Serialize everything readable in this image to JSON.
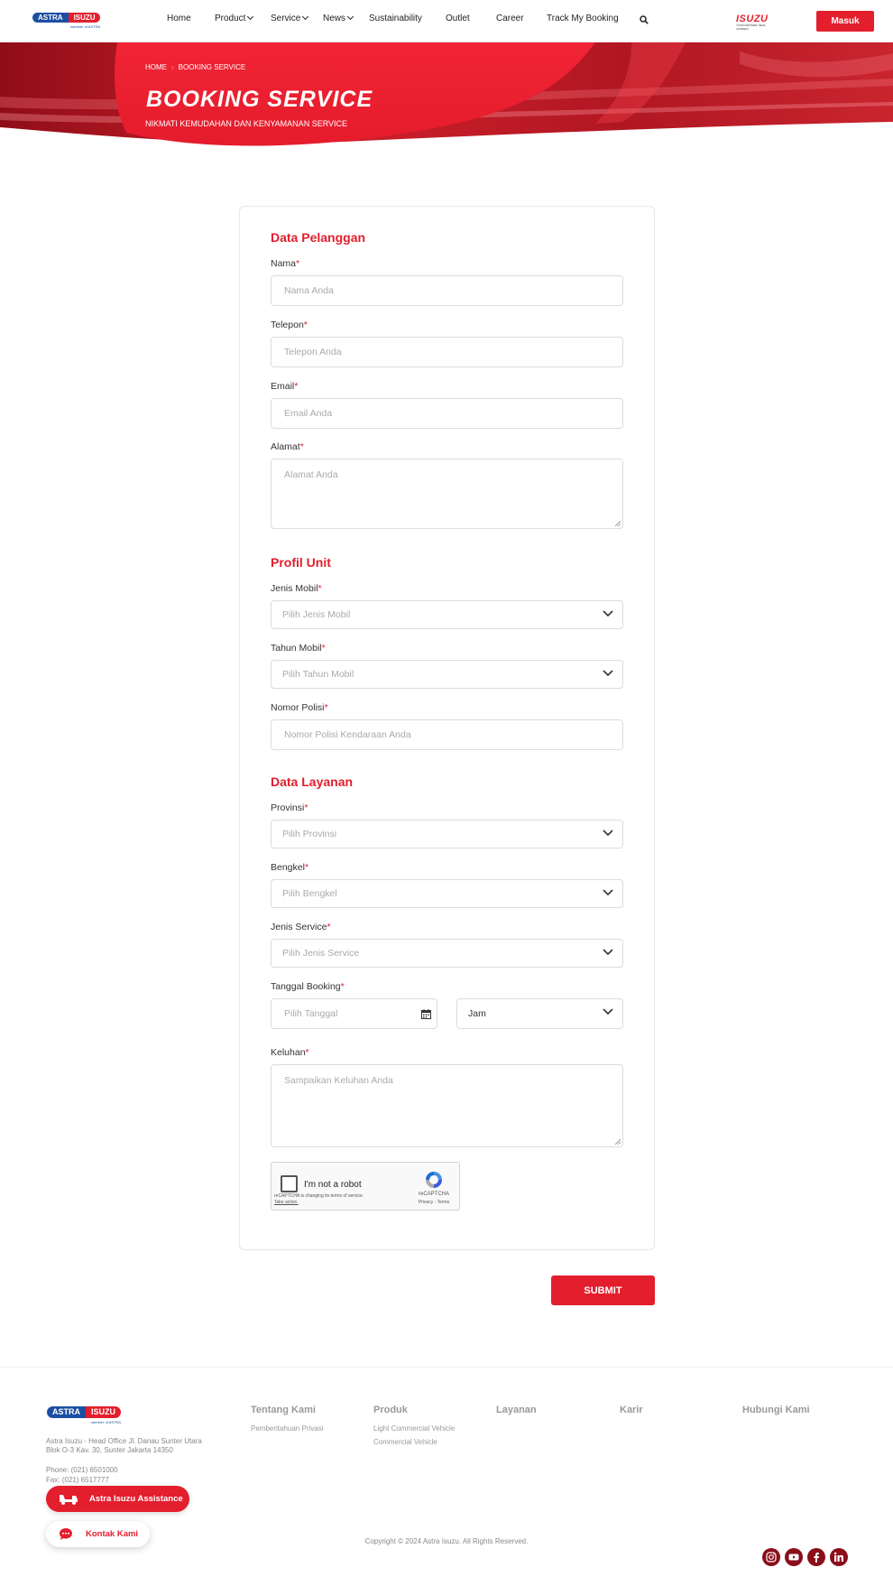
{
  "header": {
    "logo_text_left": "ASTRA",
    "logo_text_right": "ISUZU",
    "logo_sub": "member of ASTRA",
    "nav": [
      {
        "label": "Home",
        "dropdown": false
      },
      {
        "label": "Product",
        "dropdown": true
      },
      {
        "label": "Service",
        "dropdown": true
      },
      {
        "label": "News",
        "dropdown": true
      },
      {
        "label": "Sustainability",
        "dropdown": false
      },
      {
        "label": "Outlet",
        "dropdown": false
      },
      {
        "label": "Career",
        "dropdown": false
      },
      {
        "label": "Track My Booking",
        "dropdown": false
      }
    ],
    "isuzu_logo": "ISUZU",
    "isuzu_tagline": "YOUR PARTNER. REAL JOURNEY",
    "login_label": "Masuk"
  },
  "hero": {
    "breadcrumb_home": "HOME",
    "breadcrumb_current": "BOOKING SERVICE",
    "title": "BOOKING SERVICE",
    "subtitle": "NIKMATI KEMUDAHAN DAN KENYAMANAN SERVICE"
  },
  "form": {
    "section_customer": "Data Pelanggan",
    "nama_label": "Nama",
    "nama_placeholder": "Nama Anda",
    "telepon_label": "Telepon",
    "telepon_placeholder": "Telepon Anda",
    "email_label": "Email",
    "email_placeholder": "Email Anda",
    "alamat_label": "Alamat",
    "alamat_placeholder": "Alamat Anda",
    "section_unit": "Profil Unit",
    "jenis_mobil_label": "Jenis Mobil",
    "jenis_mobil_value": "Pilih Jenis Mobil",
    "tahun_mobil_label": "Tahun Mobil",
    "tahun_mobil_value": "Pilih Tahun Mobil",
    "nomor_polisi_label": "Nomor Polisi",
    "nomor_polisi_placeholder": "Nomor Polisi Kendaraan Anda",
    "section_service": "Data Layanan",
    "provinsi_label": "Provinsi",
    "provinsi_value": "Pilih Provinsi",
    "bengkel_label": "Bengkel",
    "bengkel_value": "Pilih Bengkel",
    "jenis_service_label": "Jenis Service",
    "jenis_service_value": "Pilih Jenis Service",
    "tanggal_label": "Tanggal Booking",
    "tanggal_placeholder": "Pilih Tanggal",
    "jam_value": "Jam",
    "keluhan_label": "Keluhan",
    "keluhan_placeholder": "Sampaikan Keluhan Anda",
    "required_mark": "*"
  },
  "captcha": {
    "label": "I'm not a robot",
    "note": "reCAPTCHA is changing its terms of service.",
    "note_link": "Take action.",
    "brand": "reCAPTCHA",
    "links": "Privacy - Terms"
  },
  "submit_label": "SUBMIT",
  "footer": {
    "address": "Astra Isuzu - Head Office Jl. Danau Sunter Utara Blok O-3 Kav. 30, Sunter Jakarta 14350",
    "phone": "Phone: (021) 6501000",
    "fax": "Fax: (021) 6517777",
    "columns": [
      {
        "title": "Tentang Kami",
        "links": [
          "Pemberitahuan Privasi"
        ]
      },
      {
        "title": "Produk",
        "links": [
          "Light Commercial Vehicle",
          "Commercial Vehicle"
        ]
      },
      {
        "title": "Layanan",
        "links": []
      },
      {
        "title": "Karir",
        "links": []
      },
      {
        "title": "Hubungi Kami",
        "links": []
      }
    ],
    "copyright": "Copyright © 2024 Astra Isuzu. All Rights Reserved."
  },
  "floating": {
    "assistance_label": "Astra Isuzu Assistance",
    "contact_label": "Kontak Kami"
  },
  "social_icons": [
    "instagram-icon",
    "youtube-icon",
    "facebook-icon",
    "linkedin-icon"
  ],
  "colors": {
    "brand_red": "#e31e2d",
    "brand_blue": "#1b4fa3",
    "social_dark_red": "#8b0e1b"
  }
}
